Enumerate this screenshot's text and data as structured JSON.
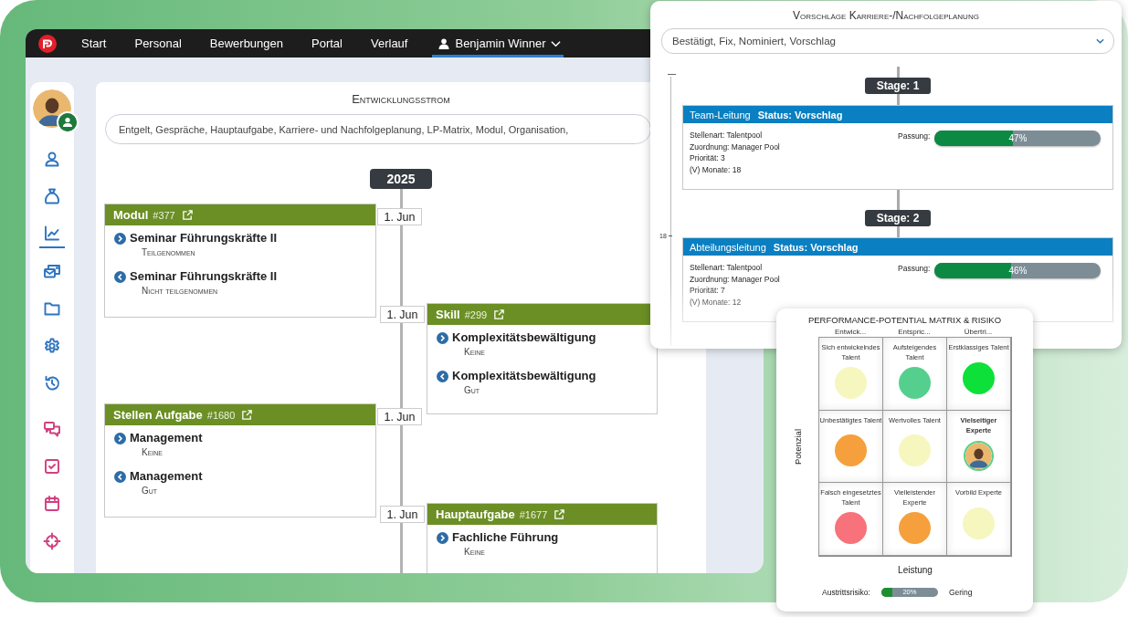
{
  "nav": {
    "items": [
      {
        "label": "Start",
        "kind": "link",
        "selected": false
      },
      {
        "label": "Personal",
        "kind": "link",
        "selected": false
      },
      {
        "label": "Bewerbungen",
        "kind": "link",
        "selected": false
      },
      {
        "label": "Portal",
        "kind": "link",
        "selected": false
      },
      {
        "label": "Verlauf",
        "kind": "link",
        "selected": false
      },
      {
        "label": "Benjamin Winner",
        "kind": "user",
        "selected": true
      }
    ]
  },
  "sidebar": {
    "items": [
      {
        "kind": "person",
        "color": "#2f74c0",
        "selected": false
      },
      {
        "kind": "bag",
        "color": "#2f74c0",
        "selected": false
      },
      {
        "kind": "chart",
        "color": "#2f74c0",
        "selected": true
      },
      {
        "kind": "mail",
        "color": "#2f74c0",
        "selected": false
      },
      {
        "kind": "folder",
        "color": "#2f74c0",
        "selected": false
      },
      {
        "kind": "gear",
        "color": "#2f74c0",
        "selected": false
      },
      {
        "kind": "history",
        "color": "#2f74c0",
        "selected": false
      },
      {
        "kind": "chat",
        "color": "#d0407f",
        "selected": false
      },
      {
        "kind": "task",
        "color": "#d0407f",
        "selected": false
      },
      {
        "kind": "calendar",
        "color": "#d0407f",
        "selected": false
      },
      {
        "kind": "target",
        "color": "#d0407f",
        "selected": false
      }
    ]
  },
  "development_stream": {
    "title": "Entwicklungsstrom",
    "filter": "Entgelt, Gespräche, Hauptaufgabe, Karriere- und Nachfolgeplanung, LP-Matrix, Modul, Organisation,",
    "year": "2025",
    "entries": [
      {
        "kind": "left",
        "type": "Modul",
        "number": "#377",
        "date": "1. Jun",
        "items": [
          {
            "kind": "forward",
            "title": "Seminar Führungskräfte II",
            "status": "Teilgenommen"
          },
          {
            "kind": "back",
            "title": "Seminar Führungskräfte II",
            "status": "Nicht teilgenommen"
          }
        ]
      },
      {
        "kind": "right",
        "type": "Skill",
        "number": "#299",
        "date": "1. Jun",
        "items": [
          {
            "kind": "forward",
            "title": "Komplexitätsbewältigung",
            "status": "Keine"
          },
          {
            "kind": "back",
            "title": "Komplexitätsbewältigung",
            "status": "Gut"
          }
        ]
      },
      {
        "kind": "left",
        "type": "Stellen Aufgabe",
        "number": "#1680",
        "date": "1. Jun",
        "items": [
          {
            "kind": "forward",
            "title": "Management",
            "status": "Keine"
          },
          {
            "kind": "back",
            "title": "Management",
            "status": "Gut"
          }
        ]
      },
      {
        "kind": "right",
        "type": "Hauptaufgabe",
        "number": "#1677",
        "date": "1. Jun",
        "items": [
          {
            "kind": "forward",
            "title": "Fachliche Führung",
            "status": "Keine"
          }
        ]
      }
    ]
  },
  "career_panel": {
    "title": "Vorschläge Karriere-/Nachfolgeplanung",
    "filter": "Bestätigt, Fix, Nominiert, Vorschlag",
    "scale_tick": "18",
    "stages": [
      {
        "label": "Stage: 1",
        "position": "Team-Leitung",
        "status": "Status: Vorschlag",
        "details": [
          "Stellenart: Talentpool",
          "Zuordnung: Manager Pool",
          "Priorität: 3",
          "(V) Monate: 18"
        ],
        "fit_label": "Passung:",
        "level": 0.47,
        "reading": "47%"
      },
      {
        "label": "Stage: 2",
        "position": "Abteilungsleitung",
        "status": "Status: Vorschlag",
        "details": [
          "Stellenart: Talentpool",
          "Zuordnung: Manager Pool",
          "Priorität: 7",
          "(V) Monate: 12"
        ],
        "fit_label": "Passung:",
        "level": 0.46,
        "reading": "46%"
      }
    ]
  },
  "matrix_panel": {
    "title": "PERFORMANCE-POTENTIAL MATRIX & RISIKO",
    "columns": [
      "Entwick...",
      "Entspric...",
      "Übertri..."
    ],
    "y_label": "Potenzial",
    "x_label": "Leistung",
    "cells": [
      {
        "label": "Sich entwickelndes Talent",
        "kind": "dot",
        "color": "#f6f6bf"
      },
      {
        "label": "Aufsteigendes Talent",
        "kind": "dot",
        "color": "#55cf8e"
      },
      {
        "label": "Erstklassiges Talent",
        "kind": "dot",
        "color": "#0ee03a"
      },
      {
        "label": "Unbestätigtes Talent",
        "kind": "dot",
        "color": "#f5a03c"
      },
      {
        "label": "Wertvolles Talent",
        "kind": "dot",
        "color": "#f6f6bf"
      },
      {
        "label": "Vielseitiger Experte",
        "kind": "avatar"
      },
      {
        "label": "Falsch eingesetztes Talent",
        "kind": "dot",
        "color": "#f7727a"
      },
      {
        "label": "Vielleistender Experte",
        "kind": "dot",
        "color": "#f5a03c"
      },
      {
        "label": "Vorbild Experte",
        "kind": "dot",
        "color": "#f6f6bf"
      }
    ],
    "risk": {
      "label": "Austrittsrisiko:",
      "level": 0.2,
      "reading": "20%",
      "rating": "Gering"
    }
  }
}
